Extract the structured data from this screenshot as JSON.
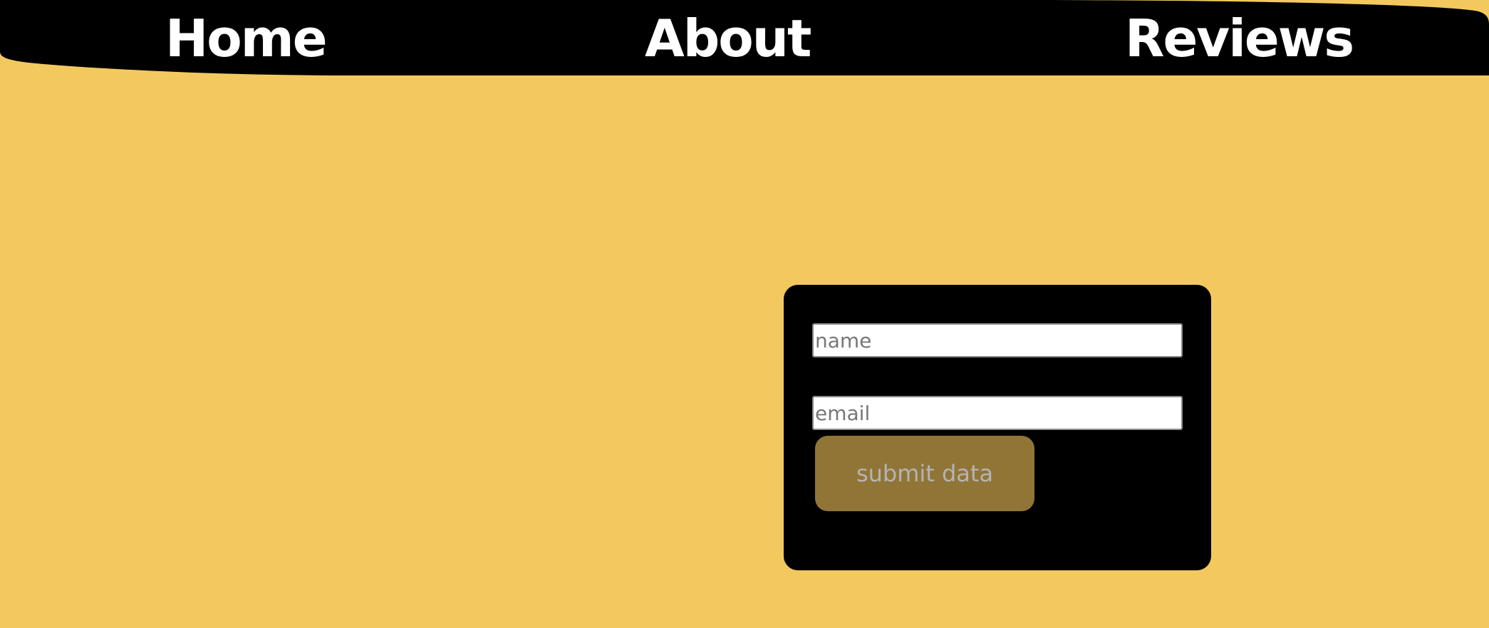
{
  "nav": {
    "items": [
      {
        "label": "Home"
      },
      {
        "label": "About"
      },
      {
        "label": "Reviews"
      }
    ]
  },
  "form": {
    "name_placeholder": "name",
    "email_placeholder": "email",
    "submit_label": "submit data"
  },
  "colors": {
    "page_background": "#f3c95f",
    "nav_background": "#000000",
    "card_background": "#000000",
    "button_background": "#917537",
    "button_text": "#b4b4b4"
  }
}
